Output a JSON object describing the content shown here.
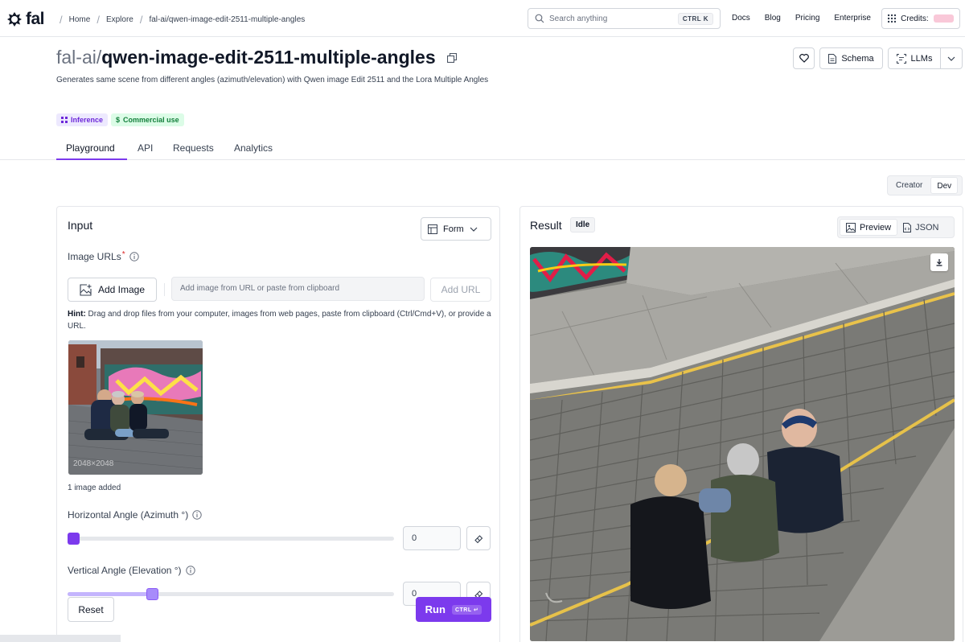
{
  "nav": {
    "brand": "fal",
    "breadcrumbs": [
      "Home",
      "Explore",
      "fal-ai/qwen-image-edit-2511-multiple-angles"
    ],
    "search_placeholder": "Search anything",
    "search_shortcut": "CTRL K",
    "links": [
      "Docs",
      "Blog",
      "Pricing",
      "Enterprise"
    ],
    "credits_label": "Credits:"
  },
  "header": {
    "title_prefix": "fal-ai/",
    "title_name": "qwen-image-edit-2511-multiple-angles",
    "description": "Generates same scene from different angles (azimuth/elevation) with Qwen image Edit 2511 and the Lora Multiple Angles",
    "tags": [
      {
        "label": "Inference",
        "icon": "grid-icon"
      },
      {
        "label": "Commercial use",
        "icon": "dollar-icon"
      }
    ],
    "actions": {
      "schema": "Schema",
      "llms": "LLMs"
    }
  },
  "tabs": [
    "Playground",
    "API",
    "Requests",
    "Analytics"
  ],
  "active_tab": "Playground",
  "mode_toggle": {
    "options": [
      "Creator",
      "Dev"
    ],
    "selected": "Dev"
  },
  "input": {
    "title": "Input",
    "form_select": "Form",
    "image_urls_label": "Image URLs",
    "add_image_label": "Add Image",
    "url_placeholder": "Add image from URL or paste from clipboard",
    "add_url_label": "Add URL",
    "hint_prefix": "Hint:",
    "hint_text": " Drag and drop files from your computer, images from web pages, paste from clipboard (Ctrl/Cmd+V), or provide a URL.",
    "thumbnail_size": "2048×2048",
    "image_count": "1 image added",
    "horizontal_label": "Horizontal Angle (Azimuth °)",
    "horizontal_value": "0",
    "horizontal_fraction": 0.0,
    "vertical_label": "Vertical Angle (Elevation °)",
    "vertical_value": "0",
    "vertical_fraction": 0.25,
    "reset_label": "Reset",
    "run_label": "Run",
    "run_shortcut": "CTRL ↵"
  },
  "result": {
    "title": "Result",
    "status": "Idle",
    "views": [
      "Preview",
      "JSON"
    ],
    "selected_view": "Preview"
  },
  "colors": {
    "accent": "#7c3aed",
    "inference_tag_bg": "#ede9fe",
    "commercial_tag_bg": "#dcfce7"
  }
}
